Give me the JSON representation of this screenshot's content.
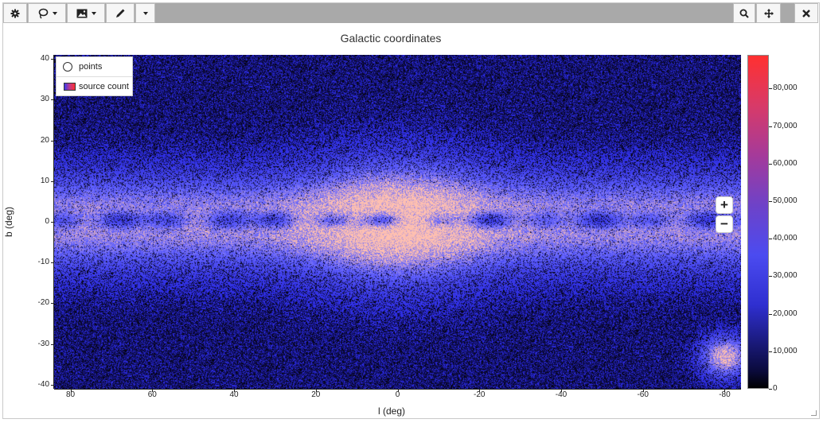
{
  "toolbar": {
    "buttons": [
      {
        "name": "settings-button",
        "icon": "gear-icon"
      },
      {
        "name": "lasso-tool-button",
        "icon": "lasso-icon"
      },
      {
        "name": "image-tool-button",
        "icon": "image-icon"
      },
      {
        "name": "pencil-tool-button",
        "icon": "pencil-icon"
      },
      {
        "name": "more-tools-button",
        "icon": "chevron-down-icon"
      },
      {
        "name": "zoom-tool-button",
        "icon": "search-icon"
      },
      {
        "name": "pan-tool-button",
        "icon": "move-icon"
      },
      {
        "name": "close-button",
        "icon": "close-icon"
      }
    ]
  },
  "legend": {
    "points_label": "points",
    "source_count_label": "source count"
  },
  "zoom": {
    "plus": "+",
    "minus": "−"
  },
  "colors": {
    "background": "#05030f",
    "low": "#2a2ae0",
    "mid": "#6a6aff",
    "high": "#ffc0b0",
    "colorbar_top": "#ff3030",
    "colorbar_bottom": "#000000"
  },
  "chart_data": {
    "type": "heatmap",
    "title": "Galactic coordinates",
    "xlabel": "l (deg)",
    "ylabel": "b (deg)",
    "xlim": [
      84,
      -84
    ],
    "ylim": [
      -41,
      41
    ],
    "x_ticks": [
      "80",
      "60",
      "40",
      "20",
      "0",
      "-20",
      "-40",
      "-60",
      "-80"
    ],
    "x_tick_values": [
      80,
      60,
      40,
      20,
      0,
      -20,
      -40,
      -60,
      -80
    ],
    "y_ticks": [
      "40",
      "30",
      "20",
      "10",
      "0",
      "-10",
      "-20",
      "-30",
      "-40"
    ],
    "y_tick_values": [
      40,
      30,
      20,
      10,
      0,
      -10,
      -20,
      -30,
      -40
    ],
    "colorbar": {
      "label": "source count",
      "range": [
        0,
        89000
      ],
      "ticks": [
        "0",
        "10,000",
        "20,000",
        "30,000",
        "40,000",
        "50,000",
        "60,000",
        "70,000",
        "80,000"
      ],
      "tick_values": [
        0,
        10000,
        20000,
        30000,
        40000,
        50000,
        60000,
        70000,
        80000
      ]
    },
    "features": [
      {
        "name": "galactic bulge",
        "l": 0,
        "b": 0
      },
      {
        "name": "Large Magellanic Cloud",
        "l": -80,
        "b": -33
      }
    ],
    "legend_position": "top-left",
    "grid": false
  }
}
